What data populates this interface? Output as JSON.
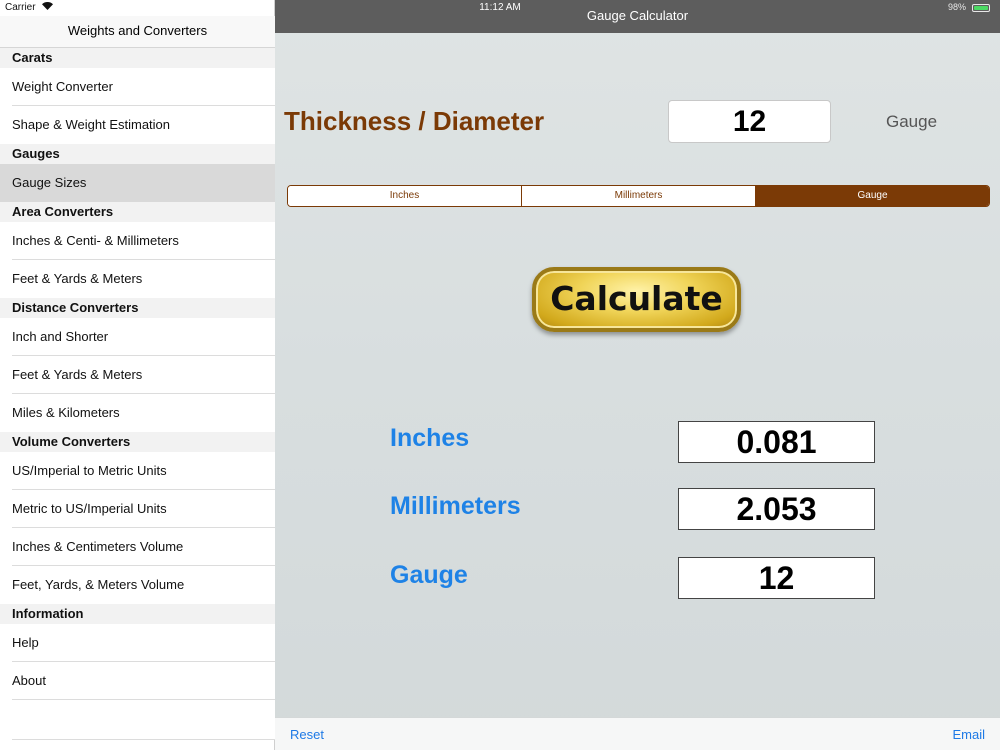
{
  "status": {
    "carrier": "Carrier",
    "time": "11:12 AM",
    "battery": "98%"
  },
  "sidebar": {
    "title": "Weights and Converters",
    "sections": [
      {
        "header": "Carats",
        "items": [
          "Weight Converter",
          "Shape & Weight Estimation"
        ]
      },
      {
        "header": "Gauges",
        "items": [
          "Gauge Sizes"
        ]
      },
      {
        "header": "Area Converters",
        "items": [
          "Inches & Centi- & Millimeters",
          "Feet & Yards & Meters"
        ]
      },
      {
        "header": "Distance Converters",
        "items": [
          "Inch and Shorter",
          "Feet & Yards & Meters",
          "Miles & Kilometers"
        ]
      },
      {
        "header": "Volume Converters",
        "items": [
          "US/Imperial to Metric Units",
          "Metric to US/Imperial Units",
          "Inches & Centimeters Volume",
          "Feet, Yards, & Meters Volume"
        ]
      },
      {
        "header": "Information",
        "items": [
          "Help",
          "About"
        ]
      }
    ],
    "selected": "Gauge Sizes"
  },
  "main": {
    "nav_title": "Gauge Calculator",
    "input_label": "Thickness / Diameter",
    "input_value": "12",
    "input_unit": "Gauge",
    "segments": [
      "Inches",
      "Millimeters",
      "Gauge"
    ],
    "selected_segment": "Gauge",
    "calculate_label": "Calculate",
    "results": [
      {
        "label": "Inches",
        "value": "0.081"
      },
      {
        "label": "Millimeters",
        "value": "2.053"
      },
      {
        "label": "Gauge",
        "value": "12"
      }
    ],
    "toolbar": {
      "reset": "Reset",
      "email": "Email"
    }
  },
  "colors": {
    "accent_brown": "#7b3a06",
    "accent_blue": "#1e82e6",
    "nav_bg": "#5d5d5d",
    "battery": "#4cd964"
  }
}
